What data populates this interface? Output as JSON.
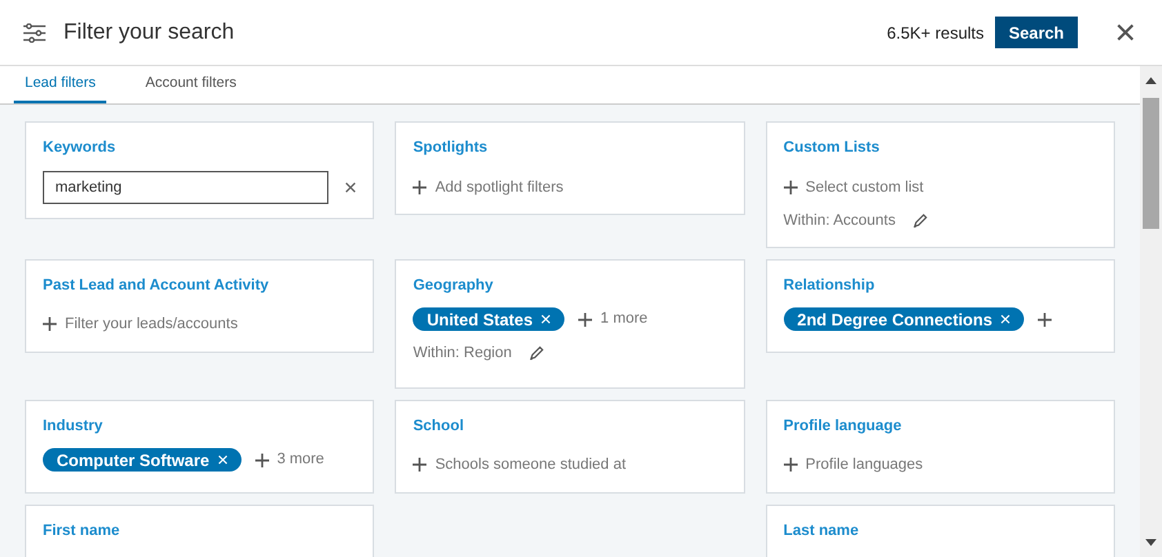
{
  "header": {
    "title": "Filter your search",
    "results": "6.5K+ results",
    "search_button": "Search"
  },
  "tabs": [
    {
      "label": "Lead filters",
      "selected": true
    },
    {
      "label": "Account filters",
      "selected": false
    }
  ],
  "filters": [
    {
      "kind": "input",
      "title": "Keywords",
      "value": "marketing"
    },
    {
      "kind": "add",
      "title": "Spotlights",
      "placeholder": "Add spotlight filters"
    },
    {
      "kind": "add",
      "title": "Custom Lists",
      "placeholder": "Select custom list",
      "within": "Within: Accounts"
    },
    {
      "kind": "add",
      "title": "Past Lead and Account Activity",
      "placeholder": "Filter your leads/accounts"
    },
    {
      "kind": "chips",
      "title": "Geography",
      "chips": [
        "United States"
      ],
      "more": "1 more",
      "within": "Within: Region"
    },
    {
      "kind": "chips",
      "title": "Relationship",
      "chips": [
        "2nd Degree Connections"
      ]
    },
    {
      "kind": "chips",
      "title": "Industry",
      "chips": [
        "Computer Software"
      ],
      "more": "3 more"
    },
    {
      "kind": "add",
      "title": "School",
      "placeholder": "Schools someone studied at"
    },
    {
      "kind": "add",
      "title": "Profile language",
      "placeholder": "Profile languages"
    },
    {
      "kind": "title",
      "title": "First name"
    },
    {
      "kind": "title",
      "title": "Last name"
    }
  ]
}
